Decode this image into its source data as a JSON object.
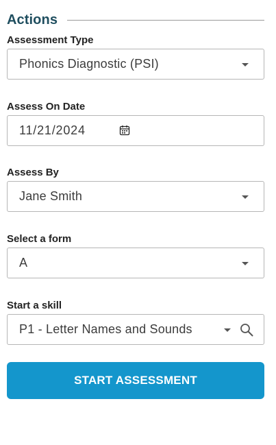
{
  "section": {
    "title": "Actions"
  },
  "assessment_type": {
    "label": "Assessment Type",
    "value": "Phonics Diagnostic (PSI)"
  },
  "assess_on_date": {
    "label": "Assess On Date",
    "value": "11/21/2024"
  },
  "assess_by": {
    "label": "Assess By",
    "value": "Jane Smith"
  },
  "form": {
    "label": "Select a form",
    "value": "A"
  },
  "skill": {
    "label": "Start a skill",
    "value": "P1 - Letter Names and Sounds"
  },
  "start_button": {
    "label": "START ASSESSMENT"
  },
  "icons": {
    "dropdown": "chevron-down-icon",
    "calendar": "calendar-icon",
    "search": "search-icon"
  },
  "colors": {
    "title": "#1f4e5f",
    "button": "#1496cc",
    "border": "#b5b5b5"
  }
}
